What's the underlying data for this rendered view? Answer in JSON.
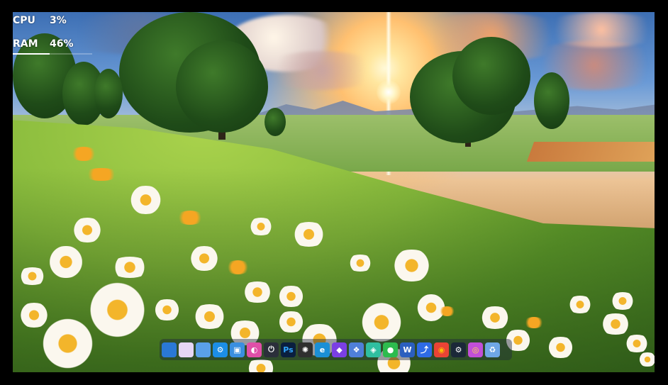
{
  "system_monitor": {
    "cpu": {
      "label": "CPU",
      "value_text": "3%",
      "fraction": 0.03
    },
    "ram": {
      "label": "RAM",
      "value_text": "46%",
      "fraction": 0.46
    }
  },
  "dock": {
    "items": [
      {
        "name": "finder-icon",
        "glyph": "",
        "bg": "#2a78d6",
        "fg": "#ffffff"
      },
      {
        "name": "window-switcher-icon",
        "glyph": "",
        "bg": "#e6d6f5",
        "fg": "#ffffff"
      },
      {
        "name": "app-launcher-icon",
        "glyph": "",
        "bg": "#5aa0ea",
        "fg": "#ffffff"
      },
      {
        "name": "settings-gear-icon",
        "glyph": "⚙",
        "bg": "#1c8ee6",
        "fg": "#ffffff"
      },
      {
        "name": "screenshot-tool-icon",
        "glyph": "▣",
        "bg": "#3a8fe0",
        "fg": "#ffffff"
      },
      {
        "name": "color-picker-icon",
        "glyph": "◐",
        "bg": "#e04fa8",
        "fg": "#ffffff"
      },
      {
        "name": "power-icon",
        "glyph": "⏻",
        "bg": "#2b2f3a",
        "fg": "#ffffff"
      },
      {
        "name": "photoshop-icon",
        "glyph": "Ps",
        "bg": "#0a1f3f",
        "fg": "#31a8ff"
      },
      {
        "name": "chatgpt-icon",
        "glyph": "✺",
        "bg": "#2f2f2f",
        "fg": "#ffffff"
      },
      {
        "name": "edge-browser-icon",
        "glyph": "e",
        "bg": "#1b8fd6",
        "fg": "#ffffff"
      },
      {
        "name": "obsidian-icon",
        "glyph": "◆",
        "bg": "#7b3fe4",
        "fg": "#ffffff"
      },
      {
        "name": "network-icon",
        "glyph": "❖",
        "bg": "#4f7fd9",
        "fg": "#ffffff"
      },
      {
        "name": "3d-cube-icon",
        "glyph": "◈",
        "bg": "#2fbfa0",
        "fg": "#ffffff"
      },
      {
        "name": "wechat-icon",
        "glyph": "●",
        "bg": "#2dbb4e",
        "fg": "#ffffff"
      },
      {
        "name": "word-icon",
        "glyph": "W",
        "bg": "#2b5fbf",
        "fg": "#ffffff"
      },
      {
        "name": "feishu-icon",
        "glyph": "⤴",
        "bg": "#2e6be6",
        "fg": "#ffffff"
      },
      {
        "name": "chrome-icon",
        "glyph": "◉",
        "bg": "#ea4335",
        "fg": "#fbbc05"
      },
      {
        "name": "steam-icon",
        "glyph": "⚙",
        "bg": "#1b2838",
        "fg": "#ffffff"
      },
      {
        "name": "color-wheel-icon",
        "glyph": "◎",
        "bg": "#c24fd8",
        "fg": "#ffe14a"
      },
      {
        "name": "recycle-bin-icon",
        "glyph": "♻",
        "bg": "#6fa7e6",
        "fg": "#ffffff"
      }
    ]
  }
}
